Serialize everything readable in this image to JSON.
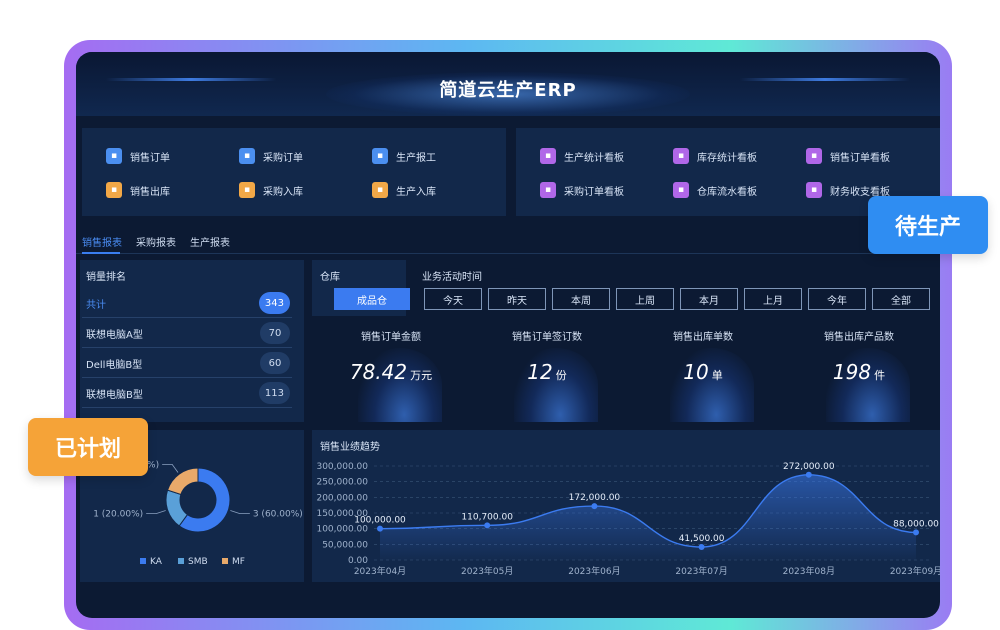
{
  "app": {
    "title": "简道云生产ERP"
  },
  "shortcuts_left": [
    {
      "label": "销售订单",
      "icon": "document-icon",
      "color": "#4b8ff0"
    },
    {
      "label": "采购订单",
      "icon": "cart-icon",
      "color": "#4b8ff0"
    },
    {
      "label": "生产报工",
      "icon": "report-icon",
      "color": "#4b8ff0"
    },
    {
      "label": "销售出库",
      "icon": "box-out-icon",
      "color": "#f2a847"
    },
    {
      "label": "采购入库",
      "icon": "box-in-icon",
      "color": "#f2a847"
    },
    {
      "label": "生产入库",
      "icon": "box-in-icon",
      "color": "#f2a847"
    }
  ],
  "shortcuts_right": [
    {
      "label": "生产统计看板",
      "icon": "dashboard-icon",
      "color": "#b067e8"
    },
    {
      "label": "库存统计看板",
      "icon": "cube-icon",
      "color": "#b067e8"
    },
    {
      "label": "销售订单看板",
      "icon": "chart-icon",
      "color": "#b067e8"
    },
    {
      "label": "采购订单看板",
      "icon": "list-icon",
      "color": "#b067e8"
    },
    {
      "label": "仓库流水看板",
      "icon": "warehouse-icon",
      "color": "#b067e8"
    },
    {
      "label": "财务收支看板",
      "icon": "wallet-icon",
      "color": "#b067e8"
    }
  ],
  "tabs": [
    {
      "label": "销售报表"
    },
    {
      "label": "采购报表"
    },
    {
      "label": "生产报表"
    }
  ],
  "ranking": {
    "title": "销量排名",
    "rows": [
      {
        "label": "共计",
        "value": "343"
      },
      {
        "label": "联想电脑A型",
        "value": "70"
      },
      {
        "label": "Dell电脑B型",
        "value": "60"
      },
      {
        "label": "联想电脑B型",
        "value": "113"
      }
    ]
  },
  "warehouse": {
    "title": "仓库",
    "selected": "成品仓"
  },
  "time_filter": {
    "title": "业务活动时间",
    "options": [
      "今天",
      "昨天",
      "本周",
      "上周",
      "本月",
      "上月",
      "今年",
      "全部"
    ]
  },
  "kpis": [
    {
      "label": "销售订单金额",
      "value": "78.42",
      "unit": "万元"
    },
    {
      "label": "销售订单签订数",
      "value": "12",
      "unit": "份"
    },
    {
      "label": "销售出库单数",
      "value": "10",
      "unit": "单"
    },
    {
      "label": "销售出库产品数",
      "value": "198",
      "unit": "件"
    }
  ],
  "status_badges": {
    "planned": "已计划",
    "pending": "待生产"
  },
  "chart_data": [
    {
      "type": "pie",
      "labels": [
        "KA",
        "SMB",
        "MF"
      ],
      "slice_labels": [
        "3 (60.00%)",
        "1 (20.00%)",
        "1 (20.00%)"
      ],
      "values": [
        3,
        1,
        1
      ],
      "colors": [
        "#3b7bf0",
        "#5aa0d8",
        "#e8a96a"
      ],
      "legend": "bottom"
    },
    {
      "type": "area",
      "title": "销售业绩趋势",
      "x": [
        "2023年04月",
        "2023年05月",
        "2023年06月",
        "2023年07月",
        "2023年08月",
        "2023年09月"
      ],
      "values": [
        100000,
        110700,
        172000,
        41500,
        272000,
        88000
      ],
      "data_labels": [
        "100,000.00",
        "110,700.00",
        "172,000.00",
        "41,500.00",
        "272,000.00",
        "88,000.00"
      ],
      "y_ticks": [
        "0.00",
        "50,000.00",
        "100,000.00",
        "150,000.00",
        "200,000.00",
        "250,000.00",
        "300,000.00"
      ],
      "ylim": [
        0,
        300000
      ],
      "grid": true,
      "color": "#3b7bf0"
    }
  ]
}
